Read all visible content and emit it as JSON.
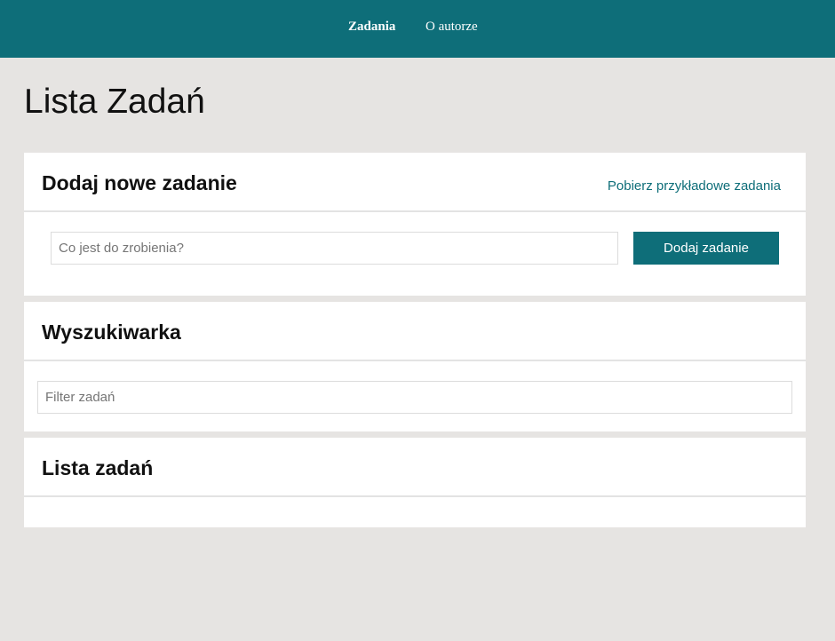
{
  "nav": {
    "items": [
      {
        "label": "Zadania",
        "active": true
      },
      {
        "label": "O autorze",
        "active": false
      }
    ]
  },
  "page": {
    "title": "Lista Zadań"
  },
  "add_task": {
    "title": "Dodaj nowe zadanie",
    "sample_link": "Pobierz przykładowe zadania",
    "input_placeholder": "Co jest do zrobienia?",
    "input_value": "",
    "button_label": "Dodaj zadanie"
  },
  "search": {
    "title": "Wyszukiwarka",
    "input_placeholder": "Filter zadań",
    "input_value": ""
  },
  "task_list": {
    "title": "Lista zadań",
    "items": []
  },
  "colors": {
    "accent": "#0e6e79",
    "background": "#e6e4e2"
  }
}
